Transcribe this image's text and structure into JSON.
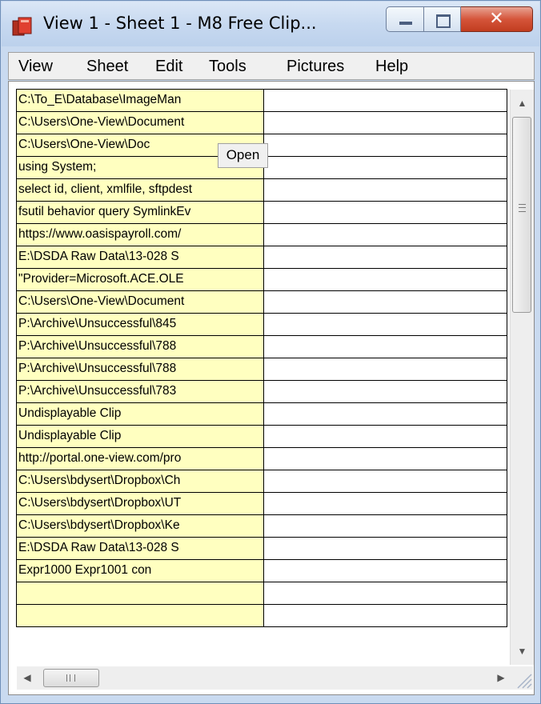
{
  "window": {
    "title": "View 1  -  Sheet 1  -  M8 Free Clip...",
    "app_icon": "m8-clipboard-icon",
    "buttons": {
      "minimize": "minimize-icon",
      "maximize": "maximize-icon",
      "close_glyph": "✕"
    }
  },
  "menu": {
    "items": [
      "View",
      "Sheet",
      "Edit",
      "Tools",
      "Pictures",
      "Help"
    ]
  },
  "clips": [
    "C:\\To_E\\Database\\ImageMan",
    "C:\\Users\\One-View\\Document",
    "C:\\Users\\One-View\\Doc",
    "using System;",
    "select id, client, xmlfile, sftpdest",
    "fsutil behavior query SymlinkEv",
    "https://www.oasispayroll.com/",
    "E:\\DSDA Raw Data\\13-028 S",
    "\"Provider=Microsoft.ACE.OLE",
    "C:\\Users\\One-View\\Document",
    "P:\\Archive\\Unsuccessful\\845",
    "P:\\Archive\\Unsuccessful\\788",
    "P:\\Archive\\Unsuccessful\\788",
    "P:\\Archive\\Unsuccessful\\783",
    "Undisplayable Clip",
    "Undisplayable Clip",
    "http://portal.one-view.com/pro",
    "C:\\Users\\bdysert\\Dropbox\\Ch",
    "C:\\Users\\bdysert\\Dropbox\\UT",
    "C:\\Users\\bdysert\\Dropbox\\Ke",
    "E:\\DSDA Raw Data\\13-028 S",
    "Expr1000    Expr1001    con",
    "",
    ""
  ],
  "tooltip": {
    "open_label": "Open"
  },
  "scrollbars": {
    "up": "▲",
    "down": "▼",
    "left": "◀",
    "right": "▶"
  },
  "colors": {
    "clip_cell": "#ffffc0",
    "titlebar": "#c7d9f0",
    "close_button": "#d5553a"
  }
}
